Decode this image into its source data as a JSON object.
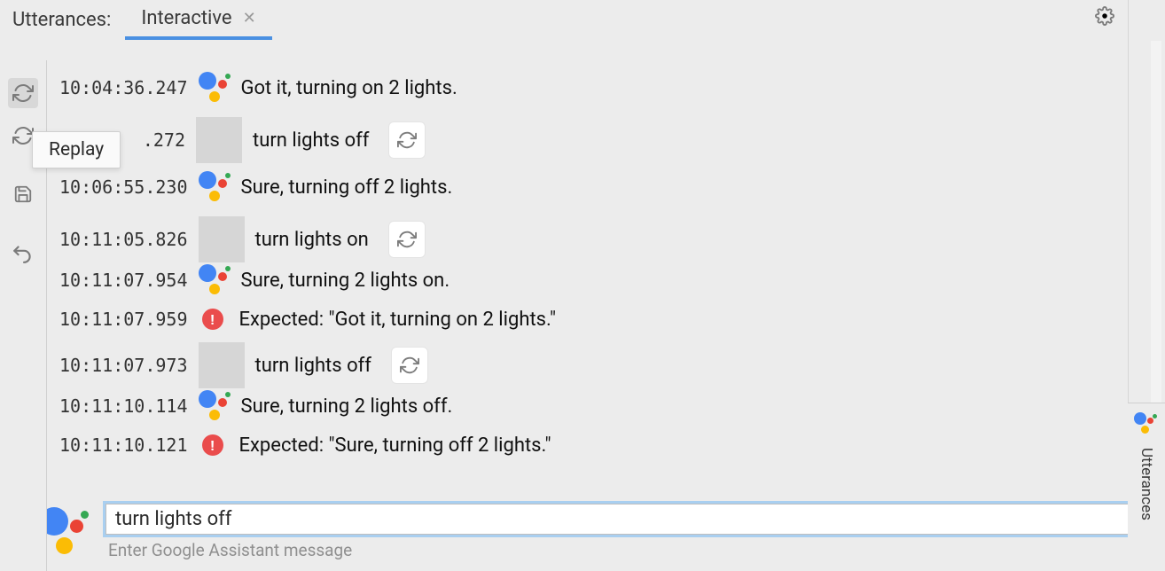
{
  "tabs": {
    "title": "Utterances:",
    "active_label": "Interactive"
  },
  "tooltip": {
    "replay": "Replay"
  },
  "conversation": [
    {
      "time": "10:04:36.247",
      "kind": "assistant",
      "text": "Got it, turning on 2 lights."
    },
    {
      "time": ".272",
      "kind": "user",
      "text": "turn lights off"
    },
    {
      "time": "10:06:55.230",
      "kind": "assistant",
      "text": "Sure, turning off 2 lights."
    },
    {
      "time": "10:11:05.826",
      "kind": "user",
      "text": "turn lights on"
    },
    {
      "time": "10:11:07.954",
      "kind": "assistant",
      "text": "Sure, turning 2 lights on."
    },
    {
      "time": "10:11:07.959",
      "kind": "error",
      "text": "Expected: \"Got it, turning on 2 lights.\""
    },
    {
      "time": "10:11:07.973",
      "kind": "user",
      "text": "turn lights off"
    },
    {
      "time": "10:11:10.114",
      "kind": "assistant",
      "text": "Sure, turning 2 lights off."
    },
    {
      "time": "10:11:10.121",
      "kind": "error",
      "text": "Expected: \"Sure, turning off 2 lights.\""
    }
  ],
  "input": {
    "value": "turn lights off",
    "helper": "Enter Google Assistant message"
  },
  "right_rail": {
    "tab_label": "Utterances"
  }
}
